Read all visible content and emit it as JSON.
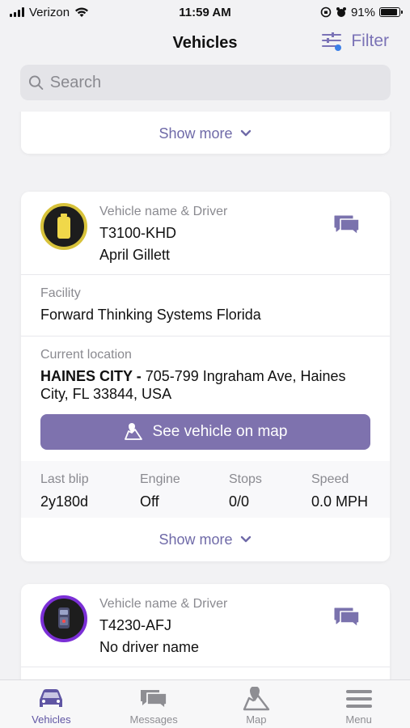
{
  "status_bar": {
    "carrier": "Verizon",
    "time": "11:59 AM",
    "battery": "91%",
    "battery_level": 0.91
  },
  "header": {
    "title": "Vehicles",
    "filter_label": "Filter"
  },
  "search": {
    "placeholder": "Search"
  },
  "cards": [
    {
      "show_more": "Show more"
    },
    {
      "label_vehicle": "Vehicle name & Driver",
      "vehicle_name": "T3100-KHD",
      "driver": "April Gillett",
      "avatar_color": "#d7c23a",
      "facility_label": "Facility",
      "facility": "Forward Thinking Systems Florida",
      "location_label": "Current location",
      "location_city": "HAINES CITY",
      "location_sep": " - ",
      "location_address": "705-799 Ingraham Ave, Haines City, FL 33844, USA",
      "map_button": "See vehicle on map",
      "stats": [
        {
          "label": "Last blip",
          "value": "2y180d"
        },
        {
          "label": "Engine",
          "value": "Off"
        },
        {
          "label": "Stops",
          "value": "0/0"
        },
        {
          "label": "Speed",
          "value": "0.0 MPH"
        }
      ],
      "show_more": "Show more"
    },
    {
      "label_vehicle": "Vehicle name & Driver",
      "vehicle_name": "T4230-AFJ",
      "driver": "No driver name",
      "avatar_color": "#7b2fd6"
    }
  ],
  "tabs": [
    {
      "label": "Vehicles",
      "icon": "car-icon",
      "active": true
    },
    {
      "label": "Messages",
      "icon": "messages-icon",
      "active": false
    },
    {
      "label": "Map",
      "icon": "map-icon",
      "active": false
    },
    {
      "label": "Menu",
      "icon": "menu-icon",
      "active": false
    }
  ],
  "colors": {
    "accent": "#7e72ae",
    "tab_active": "#5f55a3",
    "tab_inactive": "#8e8e93"
  }
}
